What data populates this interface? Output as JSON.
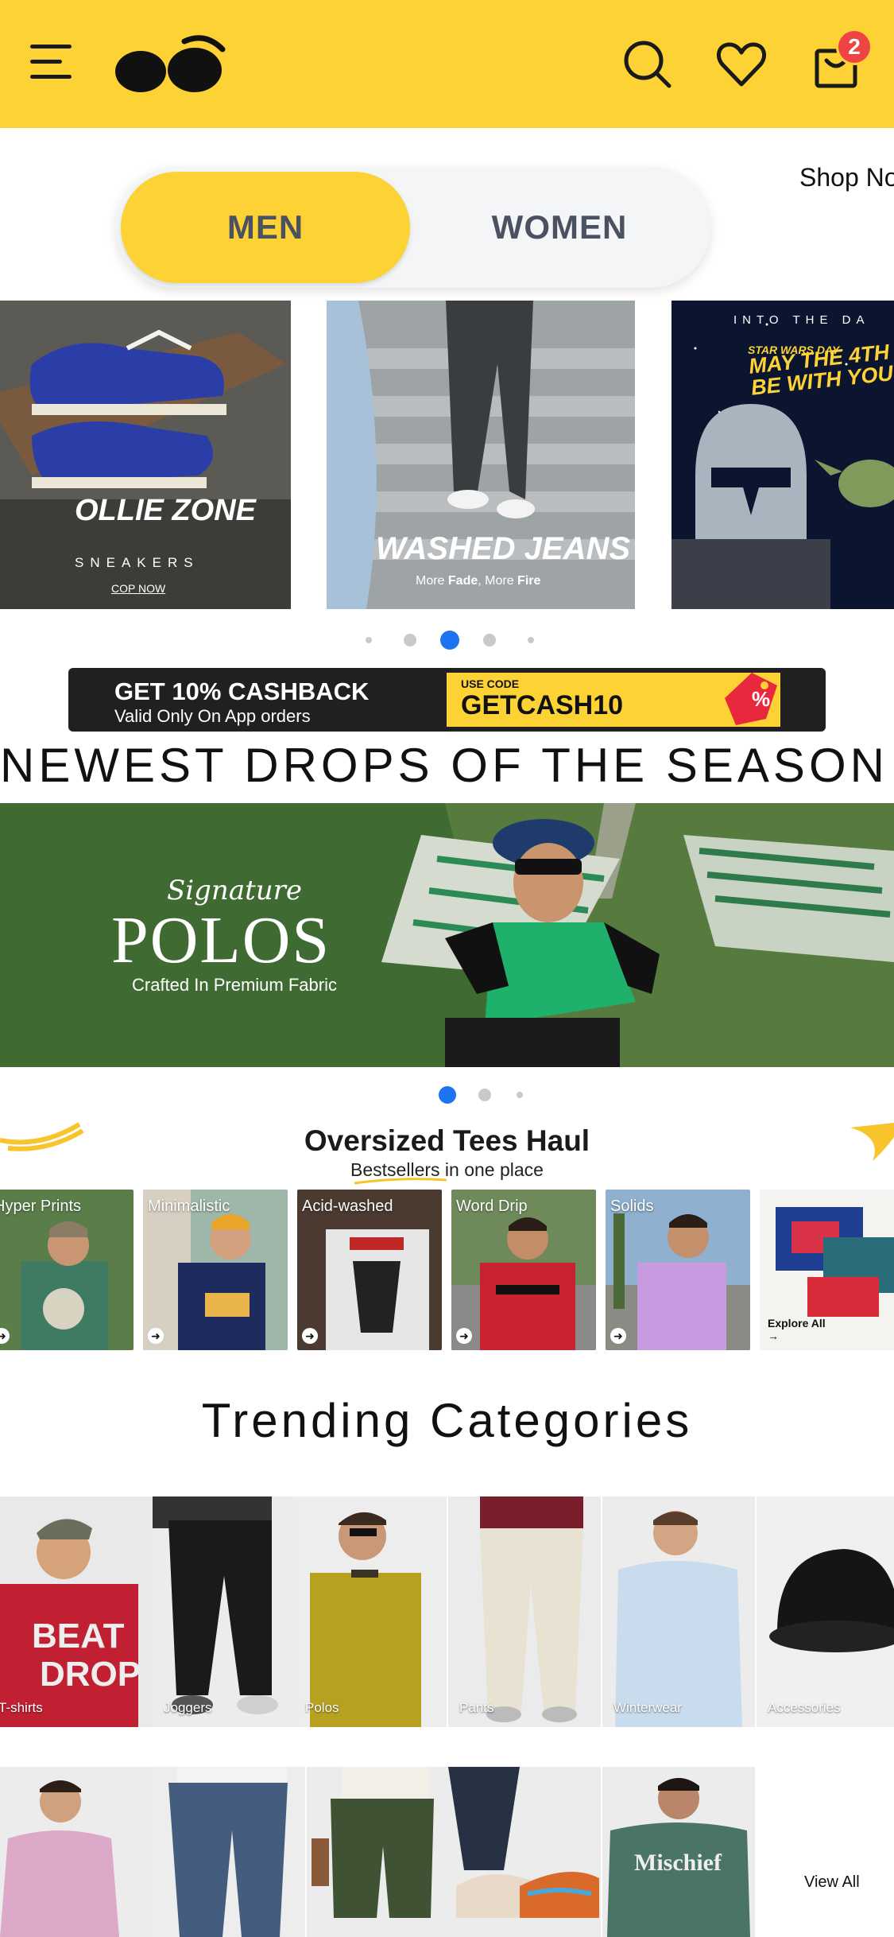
{
  "header": {
    "cart_count": "2",
    "logo": "bewakoof-logo"
  },
  "gender_toggle": {
    "men": "MEN",
    "women": "WOMEN",
    "selected": "MEN"
  },
  "shop_now_peek": "Shop No",
  "hero_banners": [
    {
      "brand": "OLLIE ZONE",
      "subtitle": "SNEAKERS",
      "cta": "COP NOW"
    },
    {
      "title": "WASHED JEANS",
      "tag_pre": "More ",
      "tag_b1": "Fade",
      "tag_mid": ", More ",
      "tag_b2": "Fire"
    },
    {
      "top": "INTO THE DA",
      "title1": "STAR WARS DAY",
      "title2": "MAY THE 4TH",
      "title3": "BE WITH YOU"
    }
  ],
  "hero_active_index": 2,
  "cashback": {
    "title": "GET 10% CASHBACK",
    "subtitle": "Valid Only On App orders",
    "code_label": "USE CODE",
    "code": "GETCASH10",
    "badge": "%"
  },
  "newest_heading": "NEWEST DROPS OF THE SEASON",
  "polo_banner": {
    "script": "Signature",
    "title": "POLOS",
    "subtitle": "Crafted In Premium Fabric"
  },
  "polo_active_index": 0,
  "oversized": {
    "title": "Oversized Tees Haul",
    "subtitle": "Bestsellers in one place",
    "tiles": [
      "Hyper Prints",
      "Minimalistic",
      "Acid-washed",
      "Word Drip",
      "Solids"
    ],
    "explore": "Explore All"
  },
  "trending_heading": "Trending Categories",
  "categories": [
    "T-shirts",
    "Joggers",
    "Polos",
    "Pants",
    "Winterwear",
    "Accessories"
  ],
  "view_all": "View All",
  "colors": {
    "brand_yellow": "#fdd235",
    "badge_red": "#ef4444",
    "dot_active": "#1e74f0",
    "dot_idle": "#c9c9c9"
  }
}
